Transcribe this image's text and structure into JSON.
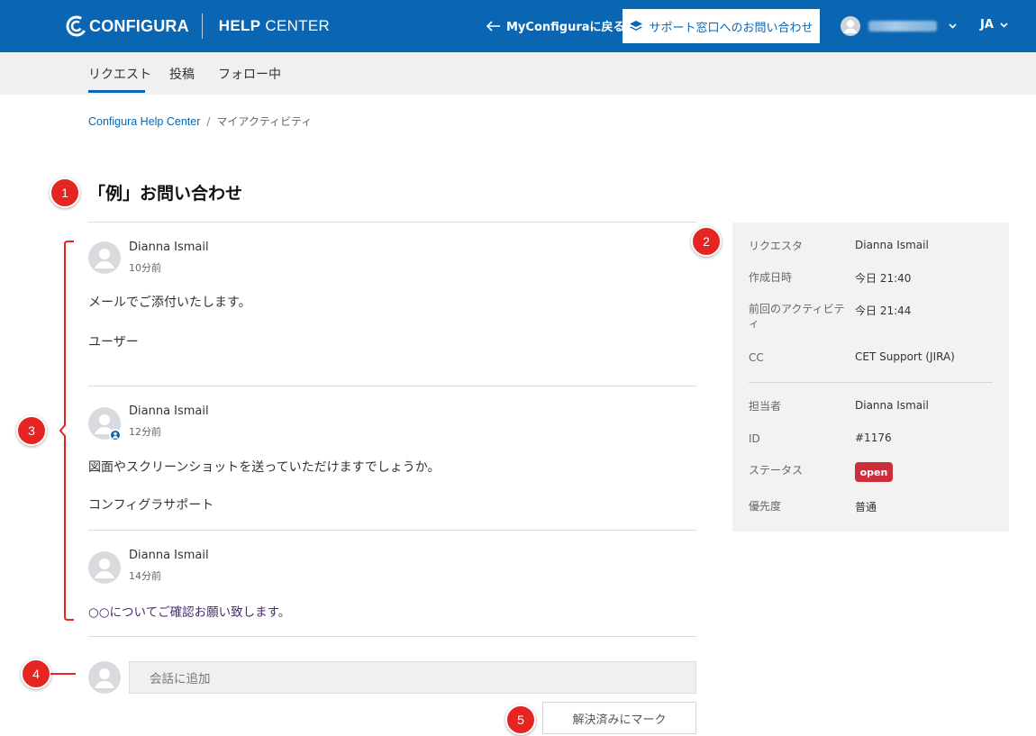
{
  "header": {
    "logo_text": "CONFIGURA",
    "help_center_bold": "HELP",
    "help_center_rest": " CENTER",
    "back_link": "MyConfiguraに戻る",
    "contact_button": "サポート窓口へのお問い合わせ",
    "language": "JA",
    "brand_color": "#0a66b3"
  },
  "subnav": {
    "tabs": [
      {
        "label": "リクエスト",
        "active": true
      },
      {
        "label": "投稿",
        "active": false
      },
      {
        "label": "フォロー中",
        "active": false
      }
    ]
  },
  "breadcrumb": {
    "root": "Configura Help Center",
    "separator": "/",
    "current": "マイアクティビティ"
  },
  "request": {
    "title": "「例」お問い合わせ"
  },
  "markers": [
    "1",
    "2",
    "3",
    "4",
    "5"
  ],
  "comments": [
    {
      "author": "Dianna Ismail",
      "time": "10分前",
      "lines": [
        "メールでご添付いたします。",
        "ユーザー"
      ],
      "agent": false
    },
    {
      "author": "Dianna Ismail",
      "time": "12分前",
      "lines": [
        "図面やスクリーンショットを送っていただけますでしょうか。",
        "コンフィグラサポート"
      ],
      "agent": true
    },
    {
      "author": "Dianna Ismail",
      "time": "14分前",
      "lines": [
        "○○についてご確認お願い致します。"
      ],
      "agent": false
    }
  ],
  "sidebar": {
    "details": [
      {
        "label": "リクエスタ",
        "value": "Dianna Ismail"
      },
      {
        "label": "作成日時",
        "value": "今日 21:40"
      },
      {
        "label": "前回のアクティビテ\nィ",
        "value": "今日 21:44"
      },
      {
        "label": "CC",
        "value": "CET Support (JIRA)"
      }
    ],
    "meta": [
      {
        "label": "担当者",
        "value": "Dianna Ismail"
      },
      {
        "label": "ID",
        "value": "#1176"
      },
      {
        "label": "ステータス",
        "value": "open"
      },
      {
        "label": "優先度",
        "value": "普通"
      }
    ],
    "status_color": "#cc2f3b"
  },
  "reply": {
    "placeholder": "会話に追加",
    "mark_solved_button": "解決済みにマーク"
  },
  "marker_color": "#e52522"
}
